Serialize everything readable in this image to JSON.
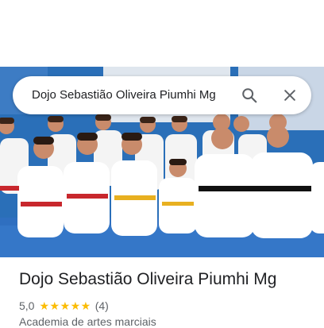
{
  "search": {
    "query": "Dojo Sebastião Oliveira Piumhi Mg",
    "search_icon": "search-icon",
    "clear_icon": "close-icon"
  },
  "photo": {
    "subject": "group-photo"
  },
  "place": {
    "name": "Dojo Sebastião Oliveira Piumhi Mg",
    "rating": "5,0",
    "stars": "★★★★★",
    "review_count": "(4)",
    "category": "Academia de artes marciais"
  },
  "colors": {
    "star": "#fbbc04",
    "text_primary": "#202124",
    "text_secondary": "#5f6368",
    "wall_blue": "#2a6fb8",
    "mat_blue": "#2f6fc0"
  }
}
